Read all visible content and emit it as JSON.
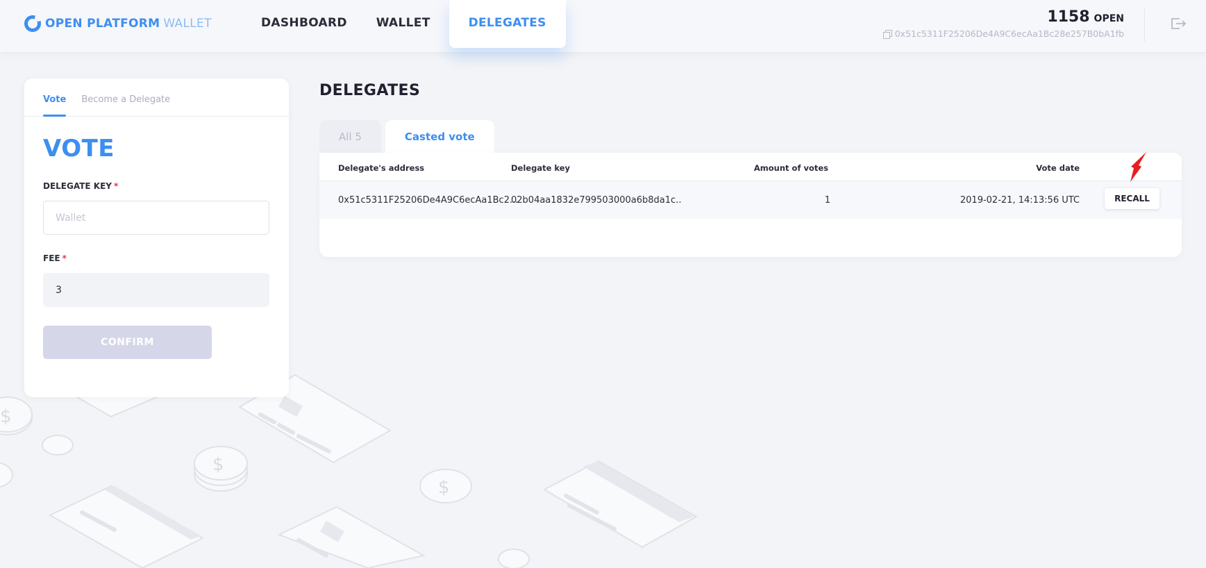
{
  "app": {
    "logo_strong": "OPEN PLATFORM",
    "logo_light": "WALLET",
    "brand_color": "#3d8ef0"
  },
  "nav": {
    "items": [
      {
        "label": "DASHBOARD"
      },
      {
        "label": "WALLET"
      },
      {
        "label": "DELEGATES",
        "active": true
      }
    ]
  },
  "account": {
    "balance": "1158",
    "currency": "OPEN",
    "address": "0x51c5311F25206De4A9C6ecAa1Bc28e257B0bA1fb"
  },
  "panel": {
    "tabs": [
      {
        "label": "Vote",
        "active": true
      },
      {
        "label": "Become a Delegate"
      }
    ],
    "title": "VOTE",
    "delegate_key_label": "DELEGATE KEY",
    "delegate_key_placeholder": "Wallet",
    "fee_label": "FEE",
    "fee_value": "3",
    "required_mark": "*",
    "confirm_label": "CONFIRM"
  },
  "main": {
    "title": "DELEGATES",
    "tabs": [
      {
        "label": "All 5"
      },
      {
        "label": "Casted vote",
        "active": true
      }
    ],
    "table": {
      "headers": [
        "Delegate's address",
        "Delegate key",
        "Amount of votes",
        "Vote date"
      ],
      "rows": [
        {
          "address": "0x51c5311F25206De4A9C6ecAa1Bc2...",
          "key": "02b04aa1832e799503000a6b8da1c..",
          "votes": "1",
          "date": "2019-02-21, 14:13:56 UTC",
          "action": "RECALL"
        }
      ]
    }
  },
  "icons": {
    "logo": "logo-icon",
    "copy": "copy-icon",
    "logout": "logout-icon",
    "annotation": "red-arrow-icon"
  },
  "colors": {
    "accent": "#3d8ef0",
    "required": "#e2364a",
    "annotation": "#e81e1e",
    "confirm_disabled": "#d5d6e8"
  }
}
